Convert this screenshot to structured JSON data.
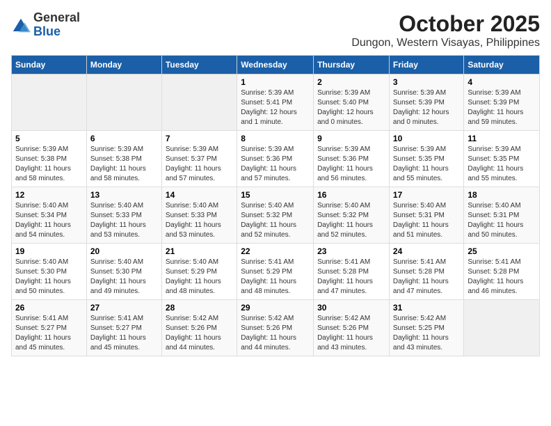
{
  "header": {
    "logo_general": "General",
    "logo_blue": "Blue",
    "title": "October 2025",
    "subtitle": "Dungon, Western Visayas, Philippines"
  },
  "days_of_week": [
    "Sunday",
    "Monday",
    "Tuesday",
    "Wednesday",
    "Thursday",
    "Friday",
    "Saturday"
  ],
  "weeks": [
    [
      {
        "date": "",
        "info": ""
      },
      {
        "date": "",
        "info": ""
      },
      {
        "date": "",
        "info": ""
      },
      {
        "date": "1",
        "info": "Sunrise: 5:39 AM\nSunset: 5:41 PM\nDaylight: 12 hours\nand 1 minute."
      },
      {
        "date": "2",
        "info": "Sunrise: 5:39 AM\nSunset: 5:40 PM\nDaylight: 12 hours\nand 0 minutes."
      },
      {
        "date": "3",
        "info": "Sunrise: 5:39 AM\nSunset: 5:39 PM\nDaylight: 12 hours\nand 0 minutes."
      },
      {
        "date": "4",
        "info": "Sunrise: 5:39 AM\nSunset: 5:39 PM\nDaylight: 11 hours\nand 59 minutes."
      }
    ],
    [
      {
        "date": "5",
        "info": "Sunrise: 5:39 AM\nSunset: 5:38 PM\nDaylight: 11 hours\nand 58 minutes."
      },
      {
        "date": "6",
        "info": "Sunrise: 5:39 AM\nSunset: 5:38 PM\nDaylight: 11 hours\nand 58 minutes."
      },
      {
        "date": "7",
        "info": "Sunrise: 5:39 AM\nSunset: 5:37 PM\nDaylight: 11 hours\nand 57 minutes."
      },
      {
        "date": "8",
        "info": "Sunrise: 5:39 AM\nSunset: 5:36 PM\nDaylight: 11 hours\nand 57 minutes."
      },
      {
        "date": "9",
        "info": "Sunrise: 5:39 AM\nSunset: 5:36 PM\nDaylight: 11 hours\nand 56 minutes."
      },
      {
        "date": "10",
        "info": "Sunrise: 5:39 AM\nSunset: 5:35 PM\nDaylight: 11 hours\nand 55 minutes."
      },
      {
        "date": "11",
        "info": "Sunrise: 5:39 AM\nSunset: 5:35 PM\nDaylight: 11 hours\nand 55 minutes."
      }
    ],
    [
      {
        "date": "12",
        "info": "Sunrise: 5:40 AM\nSunset: 5:34 PM\nDaylight: 11 hours\nand 54 minutes."
      },
      {
        "date": "13",
        "info": "Sunrise: 5:40 AM\nSunset: 5:33 PM\nDaylight: 11 hours\nand 53 minutes."
      },
      {
        "date": "14",
        "info": "Sunrise: 5:40 AM\nSunset: 5:33 PM\nDaylight: 11 hours\nand 53 minutes."
      },
      {
        "date": "15",
        "info": "Sunrise: 5:40 AM\nSunset: 5:32 PM\nDaylight: 11 hours\nand 52 minutes."
      },
      {
        "date": "16",
        "info": "Sunrise: 5:40 AM\nSunset: 5:32 PM\nDaylight: 11 hours\nand 52 minutes."
      },
      {
        "date": "17",
        "info": "Sunrise: 5:40 AM\nSunset: 5:31 PM\nDaylight: 11 hours\nand 51 minutes."
      },
      {
        "date": "18",
        "info": "Sunrise: 5:40 AM\nSunset: 5:31 PM\nDaylight: 11 hours\nand 50 minutes."
      }
    ],
    [
      {
        "date": "19",
        "info": "Sunrise: 5:40 AM\nSunset: 5:30 PM\nDaylight: 11 hours\nand 50 minutes."
      },
      {
        "date": "20",
        "info": "Sunrise: 5:40 AM\nSunset: 5:30 PM\nDaylight: 11 hours\nand 49 minutes."
      },
      {
        "date": "21",
        "info": "Sunrise: 5:40 AM\nSunset: 5:29 PM\nDaylight: 11 hours\nand 48 minutes."
      },
      {
        "date": "22",
        "info": "Sunrise: 5:41 AM\nSunset: 5:29 PM\nDaylight: 11 hours\nand 48 minutes."
      },
      {
        "date": "23",
        "info": "Sunrise: 5:41 AM\nSunset: 5:28 PM\nDaylight: 11 hours\nand 47 minutes."
      },
      {
        "date": "24",
        "info": "Sunrise: 5:41 AM\nSunset: 5:28 PM\nDaylight: 11 hours\nand 47 minutes."
      },
      {
        "date": "25",
        "info": "Sunrise: 5:41 AM\nSunset: 5:28 PM\nDaylight: 11 hours\nand 46 minutes."
      }
    ],
    [
      {
        "date": "26",
        "info": "Sunrise: 5:41 AM\nSunset: 5:27 PM\nDaylight: 11 hours\nand 45 minutes."
      },
      {
        "date": "27",
        "info": "Sunrise: 5:41 AM\nSunset: 5:27 PM\nDaylight: 11 hours\nand 45 minutes."
      },
      {
        "date": "28",
        "info": "Sunrise: 5:42 AM\nSunset: 5:26 PM\nDaylight: 11 hours\nand 44 minutes."
      },
      {
        "date": "29",
        "info": "Sunrise: 5:42 AM\nSunset: 5:26 PM\nDaylight: 11 hours\nand 44 minutes."
      },
      {
        "date": "30",
        "info": "Sunrise: 5:42 AM\nSunset: 5:26 PM\nDaylight: 11 hours\nand 43 minutes."
      },
      {
        "date": "31",
        "info": "Sunrise: 5:42 AM\nSunset: 5:25 PM\nDaylight: 11 hours\nand 43 minutes."
      },
      {
        "date": "",
        "info": ""
      }
    ]
  ]
}
